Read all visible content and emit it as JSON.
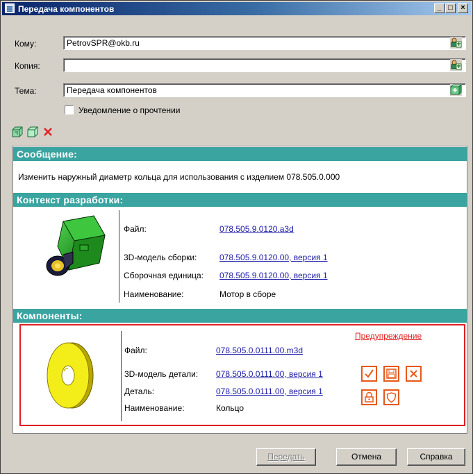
{
  "window": {
    "title": "Передача компонентов",
    "controls": {
      "minimize": "_",
      "maximize": "□",
      "close": "×"
    }
  },
  "form": {
    "to_label": "Кому:",
    "to_value": "PetrovSPR@okb.ru",
    "cc_label": "Копия:",
    "cc_value": "",
    "subject_label": "Тема:",
    "subject_value": "Передача компонентов",
    "read_receipt_label": "Уведомление о прочтении",
    "read_receipt_checked": false
  },
  "toolbar": {
    "icons": [
      "add-assembly-icon",
      "add-part-icon",
      "delete-icon"
    ]
  },
  "message_section": {
    "header": "Сообщение:",
    "text": "Изменить наружный диаметр кольца для использования  с изделием 078.505.0.000"
  },
  "context_section": {
    "header": "Контекст разработки:",
    "rows": [
      {
        "label": "Файл:",
        "value": "078.505.9.0120.a3d",
        "link": true
      },
      {
        "label": "3D-модель сборки:",
        "value": "078.505.9.0120.00, версия 1",
        "link": true
      },
      {
        "label": "Сборочная единица:",
        "value": "078.505.9.0120.00, версия 1",
        "link": true
      },
      {
        "label": "Наименование:",
        "value": "Мотор в сборе",
        "link": false
      }
    ]
  },
  "components_section": {
    "header": "Компоненты:",
    "warning": "Предупреждение",
    "rows": [
      {
        "label": "Файл:",
        "value": "078.505.0.0111.00.m3d",
        "link": true
      },
      {
        "label": "3D-модель детали:",
        "value": "078.505.0.0111.00, версия 1",
        "link": true
      },
      {
        "label": "Деталь:",
        "value": "078.505.0.0111.00, версия 1",
        "link": true
      },
      {
        "label": "Наименование:",
        "value": "Кольцо",
        "link": false
      }
    ],
    "action_icons": [
      "check-icon",
      "save-icon",
      "close-icon",
      "lock-icon",
      "shield-icon"
    ]
  },
  "buttons": {
    "send": "Передать",
    "cancel": "Отмена",
    "help": "Справка"
  },
  "colors": {
    "section_header": "#3aa4a0",
    "highlight_border": "#e02020",
    "action_icon": "#e8581a",
    "link": "#1a1aa6",
    "title_bar": "#0a246a"
  }
}
